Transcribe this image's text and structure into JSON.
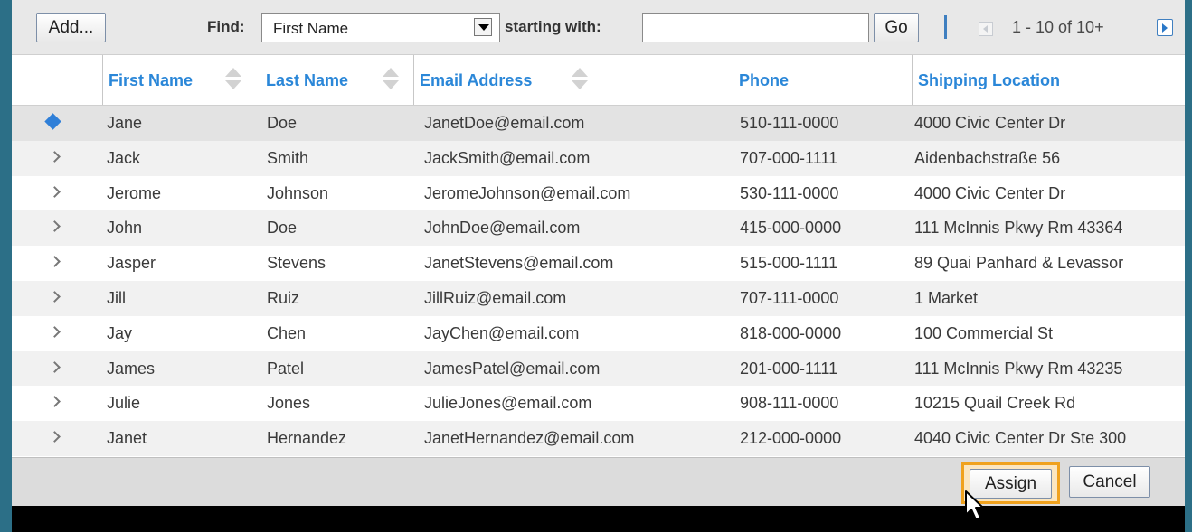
{
  "toolbar": {
    "add_label": "Add...",
    "find_label": "Find:",
    "find_field": "First Name",
    "starting_label": "starting with:",
    "search_value": "",
    "go_label": "Go",
    "page_info": "1 - 10 of 10+"
  },
  "columns": {
    "first_name": "First Name",
    "last_name": "Last Name",
    "email": "Email Address",
    "phone": "Phone",
    "shipping": "Shipping Location"
  },
  "rows": [
    {
      "first": "Jane",
      "last": "Doe",
      "email": "JanetDoe@email.com",
      "phone": "510-111-0000",
      "location": "4000 Civic Center Dr",
      "icon": "diamond-icon"
    },
    {
      "first": "Jack",
      "last": "Smith",
      "email": "JackSmith@email.com",
      "phone": "707-000-1111",
      "location": "Aidenbachstraße 56",
      "icon": "chevron-right-icon"
    },
    {
      "first": "Jerome",
      "last": "Johnson",
      "email": "JeromeJohnson@email.com",
      "phone": "530-111-0000",
      "location": "4000 Civic Center Dr",
      "icon": "chevron-right-icon"
    },
    {
      "first": "John",
      "last": "Doe",
      "email": "JohnDoe@email.com",
      "phone": "415-000-0000",
      "location": "111 McInnis Pkwy Rm 43364",
      "icon": "chevron-right-icon"
    },
    {
      "first": "Jasper",
      "last": "Stevens",
      "email": "JanetStevens@email.com",
      "phone": "515-000-1111",
      "location": "89 Quai Panhard & Levassor",
      "icon": "chevron-right-icon"
    },
    {
      "first": "Jill",
      "last": "Ruiz",
      "email": "JillRuiz@email.com",
      "phone": "707-111-0000",
      "location": "1 Market",
      "icon": "chevron-right-icon"
    },
    {
      "first": "Jay",
      "last": "Chen",
      "email": "JayChen@email.com",
      "phone": "818-000-0000",
      "location": "100 Commercial St",
      "icon": "chevron-right-icon"
    },
    {
      "first": "James",
      "last": "Patel",
      "email": "JamesPatel@email.com",
      "phone": "201-000-1111",
      "location": "111 McInnis Pkwy Rm 43235",
      "icon": "chevron-right-icon"
    },
    {
      "first": "Julie",
      "last": "Jones",
      "email": "JulieJones@email.com",
      "phone": "908-111-0000",
      "location": "10215 Quail Creek Rd",
      "icon": "chevron-right-icon"
    },
    {
      "first": "Janet",
      "last": "Hernandez",
      "email": "JanetHernandez@email.com",
      "phone": "212-000-0000",
      "location": "4040 Civic Center Dr Ste 300",
      "icon": "chevron-right-icon"
    }
  ],
  "footer": {
    "assign_label": "Assign",
    "cancel_label": "Cancel"
  },
  "colors": {
    "accent": "#2b87d8",
    "highlight": "#f0a21e",
    "background": "#2c6f87"
  }
}
